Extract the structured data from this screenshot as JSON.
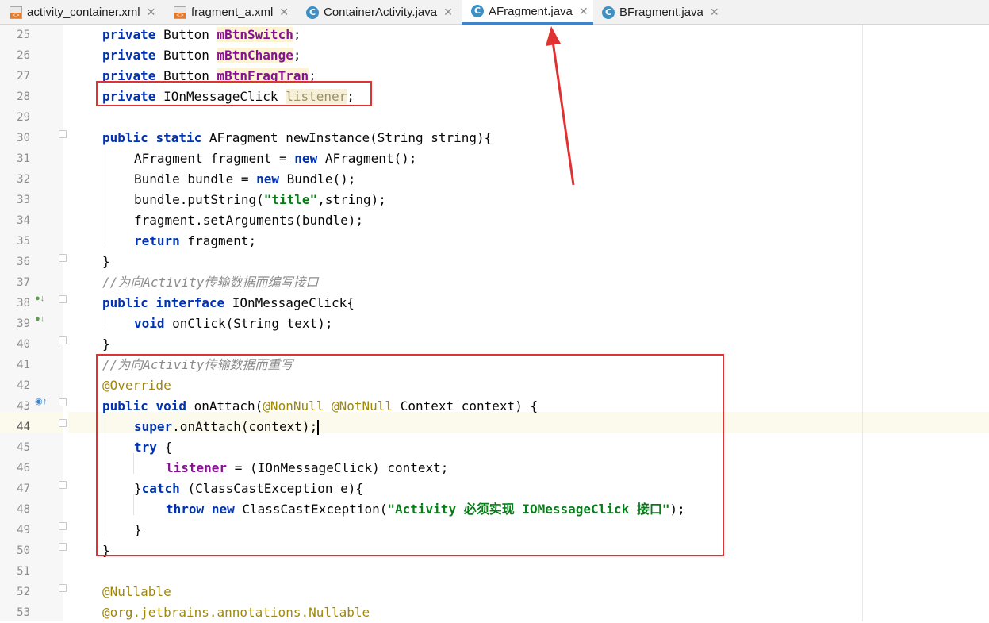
{
  "tabs": [
    {
      "label": "activity_container.xml",
      "icon": "xml-file-icon",
      "active": false
    },
    {
      "label": "fragment_a.xml",
      "icon": "xml-file-icon",
      "active": false
    },
    {
      "label": "ContainerActivity.java",
      "icon": "java-class-icon",
      "active": false
    },
    {
      "label": "AFragment.java",
      "icon": "java-class-icon",
      "active": true
    },
    {
      "label": "BFragment.java",
      "icon": "java-class-icon",
      "active": false
    }
  ],
  "editor": {
    "current_line": "44",
    "lines": [
      {
        "n": "25",
        "text": "private Button mBtnSwitch;"
      },
      {
        "n": "26",
        "text": "private Button mBtnChange;"
      },
      {
        "n": "27",
        "text": "private Button mBtnFragTran;"
      },
      {
        "n": "28",
        "text": "private IOnMessageClick listener;"
      },
      {
        "n": "29",
        "text": ""
      },
      {
        "n": "30",
        "text": "public static AFragment newInstance(String string){"
      },
      {
        "n": "31",
        "text": "AFragment fragment = new AFragment();"
      },
      {
        "n": "32",
        "text": "Bundle bundle = new Bundle();"
      },
      {
        "n": "33",
        "text": "bundle.putString(\"title\",string);"
      },
      {
        "n": "34",
        "text": "fragment.setArguments(bundle);"
      },
      {
        "n": "35",
        "text": "return fragment;"
      },
      {
        "n": "36",
        "text": "}"
      },
      {
        "n": "37",
        "text": "//为向Activity传输数据而编写接口"
      },
      {
        "n": "38",
        "text": "public interface IOnMessageClick{"
      },
      {
        "n": "39",
        "text": "void onClick(String text);"
      },
      {
        "n": "40",
        "text": "}"
      },
      {
        "n": "41",
        "text": "//为向Activity传输数据而重写"
      },
      {
        "n": "42",
        "text": "@Override"
      },
      {
        "n": "43",
        "text": "public void onAttach(@NonNull @NotNull Context context) {"
      },
      {
        "n": "44",
        "text": "super.onAttach(context);"
      },
      {
        "n": "45",
        "text": "try {"
      },
      {
        "n": "46",
        "text": "listener = (IOnMessageClick) context;"
      },
      {
        "n": "47",
        "text": "}catch (ClassCastException e){"
      },
      {
        "n": "48",
        "text": "throw new ClassCastException(\"Activity 必须实现 IOMessageClick 接口\");"
      },
      {
        "n": "49",
        "text": "}"
      },
      {
        "n": "50",
        "text": "}"
      },
      {
        "n": "51",
        "text": ""
      },
      {
        "n": "52",
        "text": "@Nullable"
      },
      {
        "n": "53",
        "text": "@org.jetbrains.annotations.Nullable"
      }
    ]
  },
  "colors": {
    "keyword": "#0033b3",
    "field": "#871094",
    "string": "#067d17",
    "comment": "#8c8c8c",
    "annotation": "#9e880d",
    "highlight_box": "#e03232",
    "active_tab_underline": "#4083c9"
  }
}
